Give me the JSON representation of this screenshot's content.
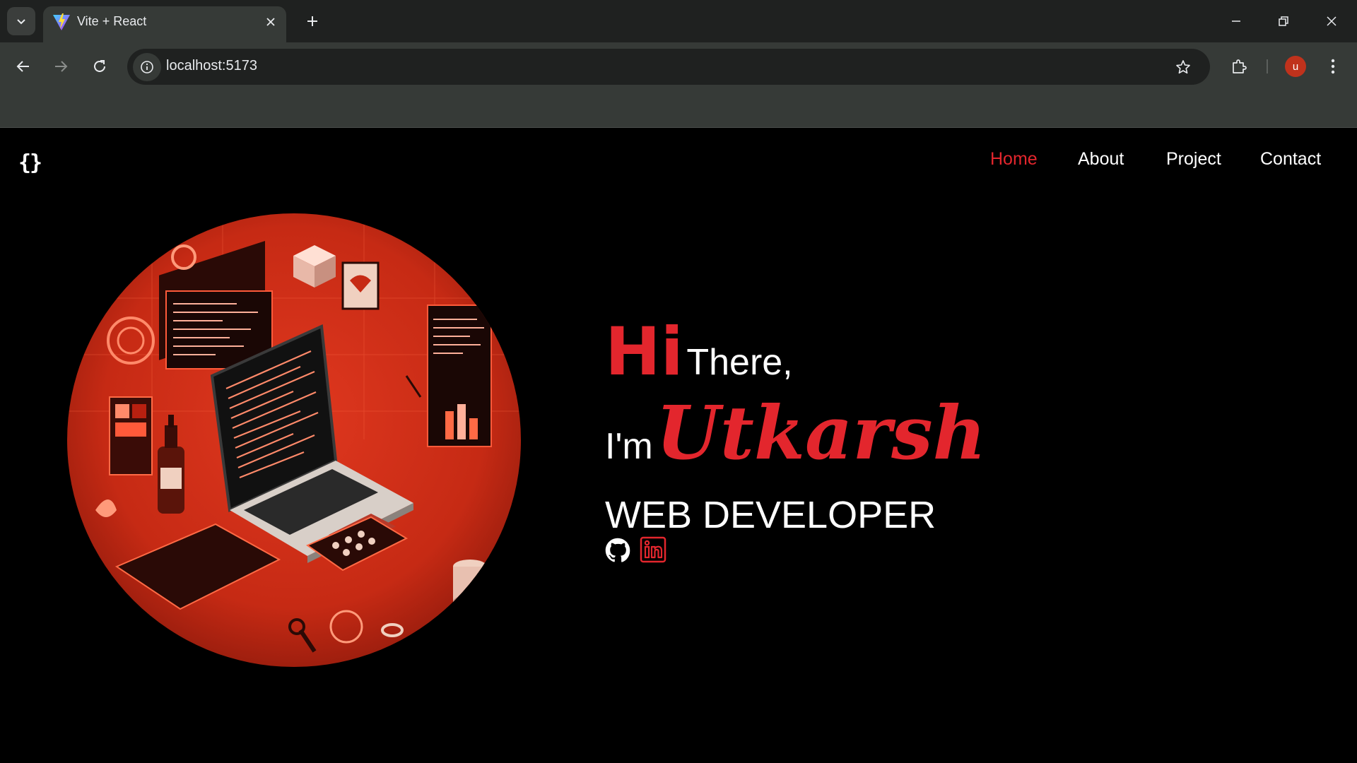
{
  "browser": {
    "tab_title": "Vite + React",
    "url": "localhost:5173",
    "profile_initial": "u"
  },
  "site": {
    "logo": "{}",
    "nav": [
      "Home",
      "About",
      "Project",
      "Contact"
    ],
    "active_nav": "Home"
  },
  "hero": {
    "greeting_hi": "Hi",
    "greeting_rest": "There,",
    "intro": "I'm",
    "name": "Utkarsh",
    "role": "WEB DEVELOPER",
    "social": [
      "github-icon",
      "linkedin-icon"
    ]
  },
  "colors": {
    "accent": "#e3262d",
    "background": "#000000",
    "text": "#ffffff"
  }
}
